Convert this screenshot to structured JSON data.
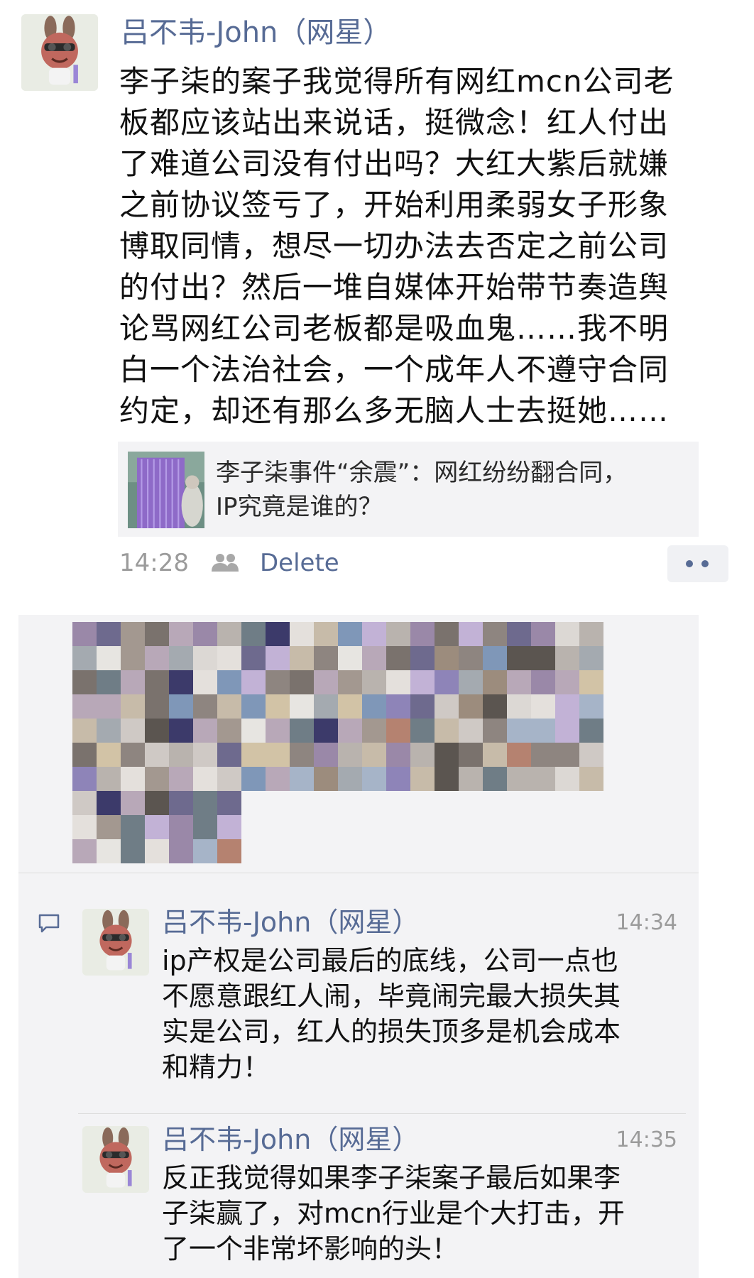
{
  "post": {
    "author": "吕不韦-John（网星）",
    "body_lines": [
      "李子柒的案子我觉得所有网红mcn公司老",
      "板都应该站出来说话，挺微念！红人付出",
      "了难道公司没有付出吗？大红大紫后就嫌",
      "之前协议签亏了，开始利用柔弱女子形象",
      "博取同情，想尽一切办法去否定之前公司",
      "的付出？然后一堆自媒体开始带节奏造舆",
      "论骂网红公司老板都是吸血鬼……我不明",
      "白一个法治社会，一个成年人不遵守合同",
      "约定，却还有那么多无脑人士去挺她……"
    ],
    "link_card": {
      "title_lines": [
        "李子柒事件“余震”：网红纷纷翻合同，",
        "IP究竟是谁的？"
      ],
      "thumbnail_icon": "article-thumbnail"
    },
    "time": "14:28",
    "visibility_icon": "friends-icon",
    "delete_label": "Delete",
    "more_icon": "more-dots-icon"
  },
  "interactions": {
    "likes_icon": "pixelated-avatars",
    "comment_icon": "comment-icon",
    "comments": [
      {
        "author": "吕不韦-John（网星）",
        "time": "14:34",
        "text_lines": [
          "ip产权是公司最后的底线，公司一点也",
          "不愿意跟红人闹，毕竟闹完最大损失其",
          "实是公司，红人的损失顶多是机会成本",
          "和精力！"
        ]
      },
      {
        "author": "吕不韦-John（网星）",
        "time": "14:35",
        "text_lines": [
          "反正我觉得如果李子柒案子最后如果李",
          "子柒赢了，对mcn行业是个大打击，开",
          "了一个非常坏影响的头！"
        ]
      }
    ]
  },
  "colors": {
    "link": "#576b95",
    "text": "#111111",
    "muted": "#9b9b9b",
    "panel": "#f3f3f5"
  }
}
